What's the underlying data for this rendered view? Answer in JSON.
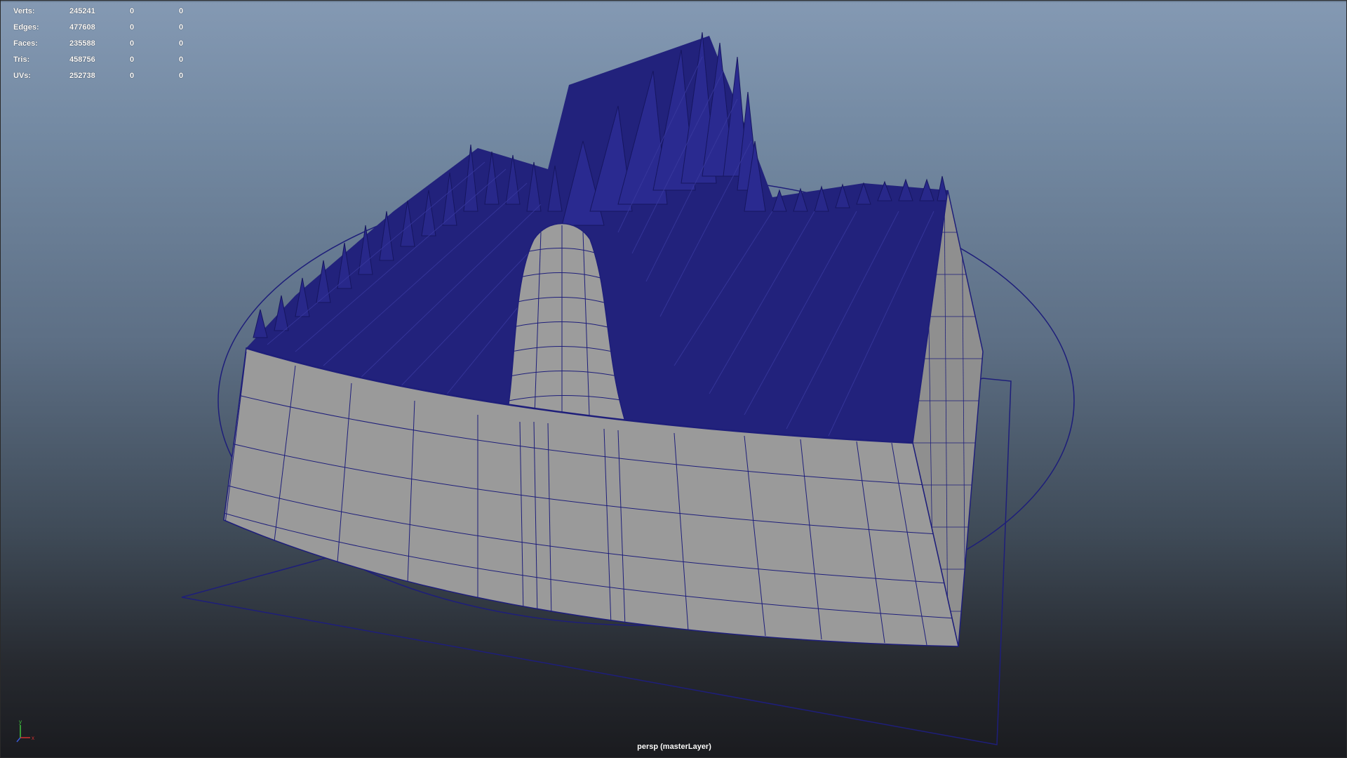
{
  "hud": {
    "rows": [
      {
        "label": "Verts:",
        "v1": "245241",
        "v2": "0",
        "v3": "0"
      },
      {
        "label": "Edges:",
        "v1": "477608",
        "v2": "0",
        "v3": "0"
      },
      {
        "label": "Faces:",
        "v1": "235588",
        "v2": "0",
        "v3": "0"
      },
      {
        "label": "Tris:",
        "v1": "458756",
        "v2": "0",
        "v3": "0"
      },
      {
        "label": "UVs:",
        "v1": "252738",
        "v2": "0",
        "v3": "0"
      }
    ]
  },
  "viewport": {
    "camera_label": "persp (masterLayer)",
    "axis": {
      "y": "y",
      "x": "x",
      "z": "z"
    }
  },
  "colors": {
    "wireframe": "#1e1e7a",
    "mesh_fill": "#9a9a9a",
    "bg_top": "#8499b3",
    "bg_bottom": "#1a1b1f"
  }
}
